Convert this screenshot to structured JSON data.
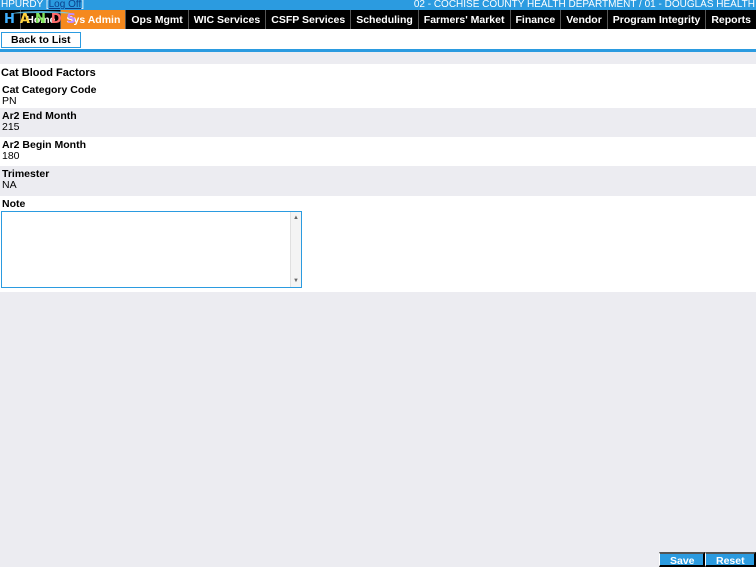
{
  "header": {
    "user": "HPURDY",
    "logoff_label": "Log Off",
    "agency": "02 - COCHISE COUNTY HEALTH DEPARTMENT / 01 - DOUGLAS HEALTH"
  },
  "logo": {
    "letters": [
      "H",
      "A",
      "N",
      "D",
      "S"
    ]
  },
  "nav": {
    "items": [
      {
        "label": "Home"
      },
      {
        "label": "Sys Admin"
      },
      {
        "label": "Ops Mgmt"
      },
      {
        "label": "WIC Services"
      },
      {
        "label": "CSFP Services"
      },
      {
        "label": "Scheduling"
      },
      {
        "label": "Farmers' Market"
      },
      {
        "label": "Finance"
      },
      {
        "label": "Vendor"
      },
      {
        "label": "Program Integrity"
      },
      {
        "label": "Reports"
      }
    ],
    "active": "Sys Admin"
  },
  "toolbar": {
    "back_label": "Back to List"
  },
  "form": {
    "title": "Cat Blood Factors",
    "fields": [
      {
        "label": "Cat Category Code",
        "value": "PN"
      },
      {
        "label": "Ar2 End Month",
        "value": "215"
      },
      {
        "label": "Ar2 Begin Month",
        "value": "180"
      },
      {
        "label": "Trimester",
        "value": "NA"
      }
    ],
    "note_label": "Note",
    "note_value": ""
  },
  "actions": {
    "save_label": "Save",
    "reset_label": "Reset"
  },
  "colors": {
    "accent": "#2b9be0",
    "active_tab": "#f5891e",
    "nav_bg": "#000000"
  }
}
